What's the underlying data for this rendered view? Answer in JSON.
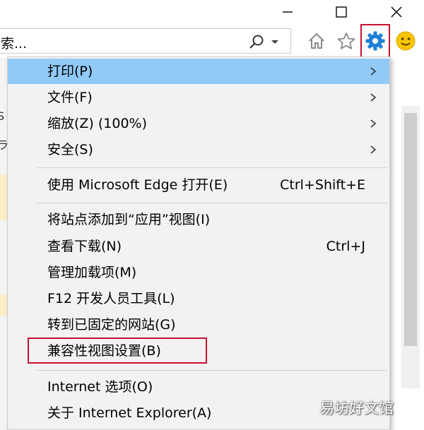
{
  "window": {
    "minimize_glyph": "—",
    "maximize_glyph": "☐",
    "close_glyph": "✕"
  },
  "address_bar": {
    "text": "索..."
  },
  "toolbar": {
    "icons": [
      "home-icon",
      "star-icon",
      "gear-icon",
      "smiley-icon"
    ],
    "gear_color": "#1e7fd8",
    "highlight_color": "#c8102e"
  },
  "background": {
    "edge_glyphs": [
      "S",
      "ラ"
    ]
  },
  "menu": {
    "highlight_color": "#91c9f7",
    "items": [
      {
        "label": "打印(P)",
        "shortcut": "",
        "submenu": true
      },
      {
        "label": "文件(F)",
        "shortcut": "",
        "submenu": true
      },
      {
        "label": "缩放(Z) (100%)",
        "shortcut": "",
        "submenu": true
      },
      {
        "label": "安全(S)",
        "shortcut": "",
        "submenu": true
      },
      {
        "label": "使用 Microsoft Edge 打开(E)",
        "shortcut": "Ctrl+Shift+E",
        "submenu": false
      },
      {
        "label": "将站点添加到“应用”视图(I)",
        "shortcut": "",
        "submenu": false
      },
      {
        "label": "查看下载(N)",
        "shortcut": "Ctrl+J",
        "submenu": false
      },
      {
        "label": "管理加载项(M)",
        "shortcut": "",
        "submenu": false
      },
      {
        "label": "F12 开发人员工具(L)",
        "shortcut": "",
        "submenu": false
      },
      {
        "label": "转到已固定的网站(G)",
        "shortcut": "",
        "submenu": false
      },
      {
        "label": "兼容性视图设置(B)",
        "shortcut": "",
        "submenu": false
      },
      {
        "label": "Internet 选项(O)",
        "shortcut": "",
        "submenu": false
      },
      {
        "label": "关于 Internet Explorer(A)",
        "shortcut": "",
        "submenu": false
      }
    ]
  },
  "watermark": {
    "text": "易坊好文馆"
  }
}
